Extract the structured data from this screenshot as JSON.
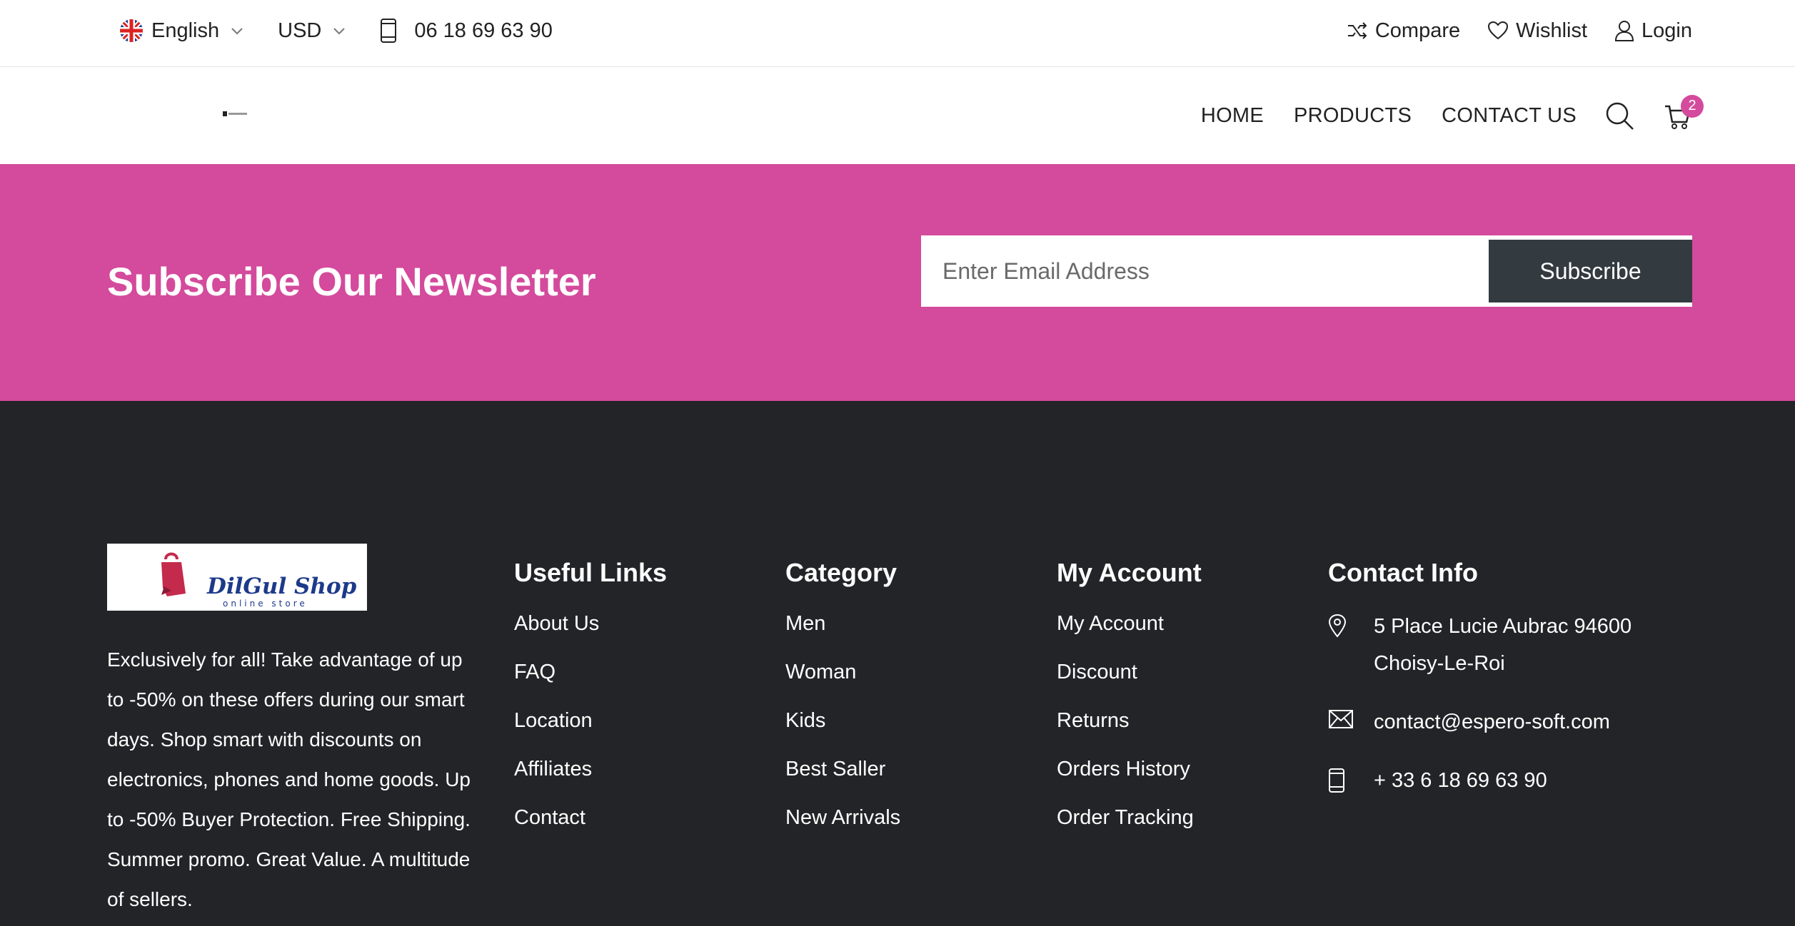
{
  "topbar": {
    "language": "English",
    "currency": "USD",
    "phone": "06 18 69 63 90",
    "compare": "Compare",
    "wishlist": "Wishlist",
    "login": "Login"
  },
  "header": {
    "nav": [
      "HOME",
      "PRODUCTS",
      "CONTACT US"
    ],
    "cart_count": "2"
  },
  "newsletter": {
    "title": "Subscribe Our Newsletter",
    "email_placeholder": "Enter Email Address",
    "subscribe_label": "Subscribe"
  },
  "footer": {
    "logo": {
      "name": "DilGul Shop",
      "tagline": "online store"
    },
    "about": "Exclusively for all! Take advantage of up to -50% on these offers during our smart days. Shop smart with discounts on electronics, phones and home goods. Up to -50% Buyer Protection. Free Shipping. Summer promo. Great Value. A multitude of sellers.",
    "useful_links": {
      "title": "Useful Links",
      "items": [
        "About Us",
        "FAQ",
        "Location",
        "Affiliates",
        "Contact"
      ]
    },
    "category": {
      "title": "Category",
      "items": [
        "Men",
        "Woman",
        "Kids",
        "Best Saller",
        "New Arrivals"
      ]
    },
    "my_account": {
      "title": "My Account",
      "items": [
        "My Account",
        "Discount",
        "Returns",
        "Orders History",
        "Order Tracking"
      ]
    },
    "contact": {
      "title": "Contact Info",
      "address_line1": "5 Place Lucie Aubrac 94600",
      "address_line2": "Choisy-Le-Roi",
      "email": "contact@espero-soft.com",
      "phone": "+ 33 6 18 69 63 90"
    }
  },
  "colors": {
    "accent": "#d44a9c",
    "footer_bg": "#232427",
    "button_dark": "#333a40"
  },
  "icons": {
    "flag": "uk-flag-icon",
    "phone": "mobile-phone-icon",
    "compare": "shuffle-icon",
    "wishlist": "heart-icon",
    "login": "user-icon",
    "search": "search-icon",
    "cart": "cart-icon",
    "address": "map-pin-icon",
    "email": "envelope-icon"
  }
}
